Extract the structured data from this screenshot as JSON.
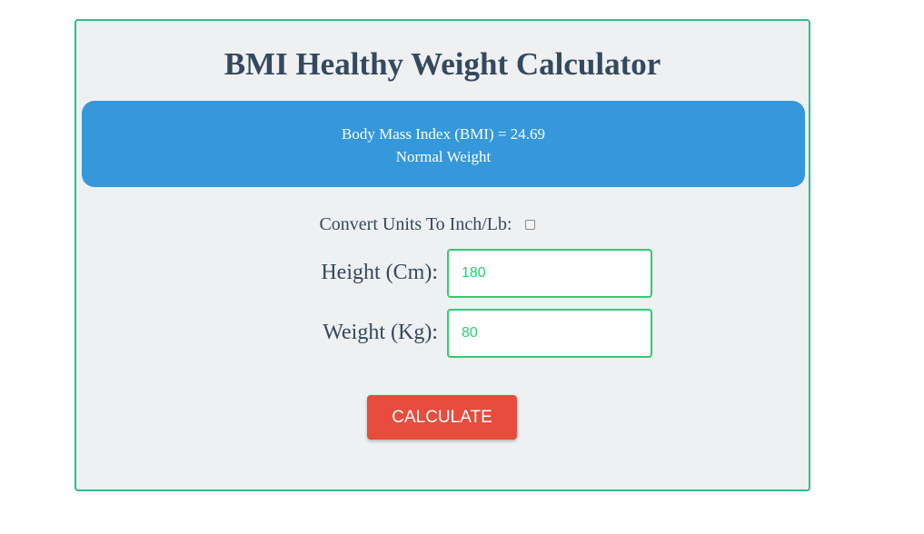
{
  "calculator": {
    "title": "BMI Healthy Weight Calculator",
    "result": {
      "bmi_line": "Body Mass Index (BMI) = 24.69",
      "category": "Normal Weight"
    },
    "convert": {
      "label": "Convert Units To Inch/Lb:",
      "checked": false
    },
    "height": {
      "label": "Height (Cm):",
      "value": "180"
    },
    "weight": {
      "label": "Weight (Kg):",
      "value": "80"
    },
    "calculate_label": "CALCULATE"
  },
  "colors": {
    "card_border": "#2ebd8b",
    "card_background": "#eef0f2",
    "title_text": "#34495e",
    "result_background": "#3498db",
    "input_border": "#2ecc71",
    "input_text": "#2ecc71",
    "button_background": "#e74c3c"
  }
}
